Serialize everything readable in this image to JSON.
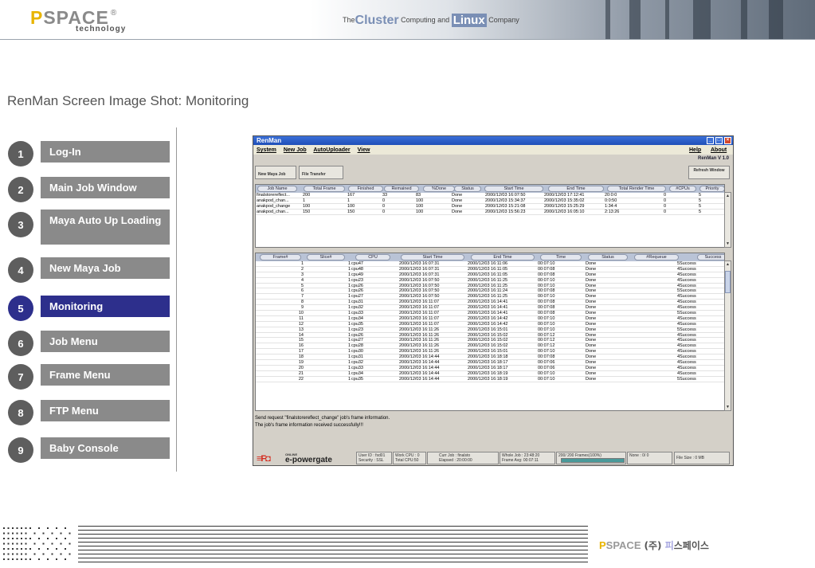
{
  "header": {
    "logo_main": "SPACE",
    "logo_p": "P",
    "logo_reg": "®",
    "logo_sub": "technology",
    "tag_the": "The",
    "tag_cluster": "Cluster",
    "tag_mid": " Computing and ",
    "tag_linux": "Linux",
    "tag_company": " Company"
  },
  "page_title": "RenMan Screen Image Shot: Monitoring",
  "nav": [
    {
      "num": "1",
      "label": "Log-In"
    },
    {
      "num": "2",
      "label": "Main Job Window"
    },
    {
      "num": "3",
      "label": "Maya Auto Up Loading"
    },
    {
      "num": "4",
      "label": "New Maya Job"
    },
    {
      "num": "5",
      "label": "Monitoring",
      "active": true
    },
    {
      "num": "6",
      "label": "Job Menu"
    },
    {
      "num": "7",
      "label": "Frame Menu"
    },
    {
      "num": "8",
      "label": "FTP Menu"
    },
    {
      "num": "9",
      "label": "Baby Console"
    }
  ],
  "app": {
    "title": "RenMan",
    "menu": [
      "System",
      "New Job",
      "AutoUploader",
      "View"
    ],
    "menu_right": [
      "Help",
      "About"
    ],
    "version": "RenMan V 1.0",
    "toolbar": {
      "new_maya_job": "New Maya Job",
      "file_transfer": "File Transfer",
      "refresh": "Refresh Window"
    },
    "jobs": {
      "headers": [
        "Job Name",
        "Total Frame",
        "Finished",
        "Remained",
        "%Done",
        "Status",
        "Start Time",
        "End Time",
        "Total Render Time",
        "#CPUs",
        "Priority"
      ],
      "rows": [
        [
          "finalstorereflect...",
          "200",
          "167",
          "33",
          "83",
          "Done",
          "2000/12/03 16:07:50",
          "2000/12/03 17:12:41",
          "20:0:0",
          "0",
          "5"
        ],
        [
          "anakpod_chan...",
          "1",
          "1",
          "0",
          "100",
          "Done",
          "2000/12/03 15:34:37",
          "2000/12/03 15:35:02",
          "0:0:50",
          "0",
          "5"
        ],
        [
          "anakpod_change",
          "100",
          "100",
          "0",
          "100",
          "Done",
          "2000/12/03 15:21:08",
          "2000/12/03 15:25:29",
          "1:34:4",
          "0",
          "5"
        ],
        [
          "anakpod_chan...",
          "150",
          "150",
          "0",
          "100",
          "Done",
          "2000/12/03 15:56:23",
          "2000/12/03 16:05:10",
          "2:13:26",
          "0",
          "5"
        ]
      ]
    },
    "frames": {
      "headers": [
        "Frame#",
        "Slice#",
        "CPU",
        "Start Time",
        "End Time",
        "Time",
        "Status",
        "#Requeue",
        "Success"
      ],
      "rows": [
        [
          "1",
          "1",
          "cpu47",
          "2000/12/03 16:07:31",
          "2000/12/03 16:11:06",
          "00:07:10",
          "Done",
          "5",
          "Success"
        ],
        [
          "2",
          "1",
          "cpu48",
          "2000/12/03 16:07:31",
          "2000/12/03 16:11:05",
          "00:07:08",
          "Done",
          "4",
          "Success"
        ],
        [
          "3",
          "1",
          "cpu49",
          "2000/12/03 16:07:31",
          "2000/12/03 16:11:05",
          "00:07:08",
          "Done",
          "4",
          "Success"
        ],
        [
          "4",
          "1",
          "cpu23",
          "2000/12/03 16:07:50",
          "2000/12/03 16:11:25",
          "00:07:10",
          "Done",
          "4",
          "Success"
        ],
        [
          "5",
          "1",
          "cpu26",
          "2000/12/03 16:07:50",
          "2000/12/03 16:11:25",
          "00:07:10",
          "Done",
          "4",
          "Success"
        ],
        [
          "6",
          "1",
          "cpu26",
          "2000/12/03 16:07:50",
          "2000/12/03 16:11:24",
          "00:07:08",
          "Done",
          "5",
          "Success"
        ],
        [
          "7",
          "1",
          "cpu27",
          "2000/12/03 16:07:50",
          "2000/12/03 16:11:25",
          "00:07:10",
          "Done",
          "4",
          "Success"
        ],
        [
          "8",
          "1",
          "cpu31",
          "2000/12/03 16:11:07",
          "2000/12/03 16:14:41",
          "00:07:08",
          "Done",
          "4",
          "Success"
        ],
        [
          "9",
          "1",
          "cpu32",
          "2000/12/03 16:11:07",
          "2000/12/03 16:14:41",
          "00:07:08",
          "Done",
          "4",
          "Success"
        ],
        [
          "10",
          "1",
          "cpu33",
          "2000/12/03 16:11:07",
          "2000/12/03 16:14:41",
          "00:07:08",
          "Done",
          "5",
          "Success"
        ],
        [
          "11",
          "1",
          "cpu34",
          "2000/12/03 16:11:07",
          "2000/12/03 16:14:42",
          "00:07:10",
          "Done",
          "4",
          "Success"
        ],
        [
          "12",
          "1",
          "cpu35",
          "2000/12/03 16:11:07",
          "2000/12/03 16:14:42",
          "00:07:10",
          "Done",
          "4",
          "Success"
        ],
        [
          "13",
          "1",
          "cpu23",
          "2000/12/03 16:11:26",
          "2000/12/03 16:15:01",
          "00:07:10",
          "Done",
          "5",
          "Success"
        ],
        [
          "14",
          "1",
          "cpu26",
          "2000/12/03 16:11:26",
          "2000/12/03 16:15:02",
          "00:07:12",
          "Done",
          "4",
          "Success"
        ],
        [
          "15",
          "1",
          "cpu27",
          "2000/12/03 16:11:26",
          "2000/12/03 16:15:02",
          "00:07:12",
          "Done",
          "4",
          "Success"
        ],
        [
          "16",
          "1",
          "cpu28",
          "2000/12/03 16:11:26",
          "2000/12/03 16:15:02",
          "00:07:12",
          "Done",
          "4",
          "Success"
        ],
        [
          "17",
          "1",
          "cpu30",
          "2000/12/03 16:11:26",
          "2000/12/03 16:15:01",
          "00:07:10",
          "Done",
          "4",
          "Success"
        ],
        [
          "18",
          "1",
          "cpu31",
          "2000/12/03 16:14:44",
          "2000/12/03 16:18:18",
          "00:07:08",
          "Done",
          "4",
          "Success"
        ],
        [
          "19",
          "1",
          "cpu32",
          "2000/12/03 16:14:44",
          "2000/12/03 16:18:17",
          "00:07:06",
          "Done",
          "4",
          "Success"
        ],
        [
          "20",
          "1",
          "cpu33",
          "2000/12/03 16:14:44",
          "2000/12/03 16:18:17",
          "00:07:06",
          "Done",
          "4",
          "Success"
        ],
        [
          "21",
          "1",
          "cpu34",
          "2000/12/03 16:14:44",
          "2000/12/03 16:18:19",
          "00:07:10",
          "Done",
          "4",
          "Success"
        ],
        [
          "22",
          "1",
          "cpu35",
          "2000/12/03 16:14:44",
          "2000/12/03 16:18:19",
          "00:07:10",
          "Done",
          "5",
          "Success"
        ]
      ]
    },
    "messages": [
      "Send request \"finalstorereflect_change\" job's frame information.",
      "The job's frame information received successfully!!!"
    ],
    "status": {
      "brand_online": "ONLINE",
      "brand_name": "e-powergate",
      "user": "User ID : fsd01",
      "security": "Security : SSL",
      "work_cpu": "Work CPU : 0",
      "total_cpu": "Total CPU:50",
      "curr_job": "Curr Job : finalsto",
      "elapsed": "Elapsed : 20:00:00",
      "whole_job": "Whole Job : 23:48:20",
      "frame_avg": "Frame Avg: 00:07:11",
      "frames": "200/ 200 Frames(100%)",
      "progress": 1.0,
      "none": "None : 0/ 0",
      "file_size": "File Size : 0 MB"
    }
  },
  "footer": {
    "logo_p": "P",
    "logo_main": "SPACE",
    "ko_paren": "(주)",
    "ko_pi": "피",
    "ko_rest": "스페이스"
  }
}
